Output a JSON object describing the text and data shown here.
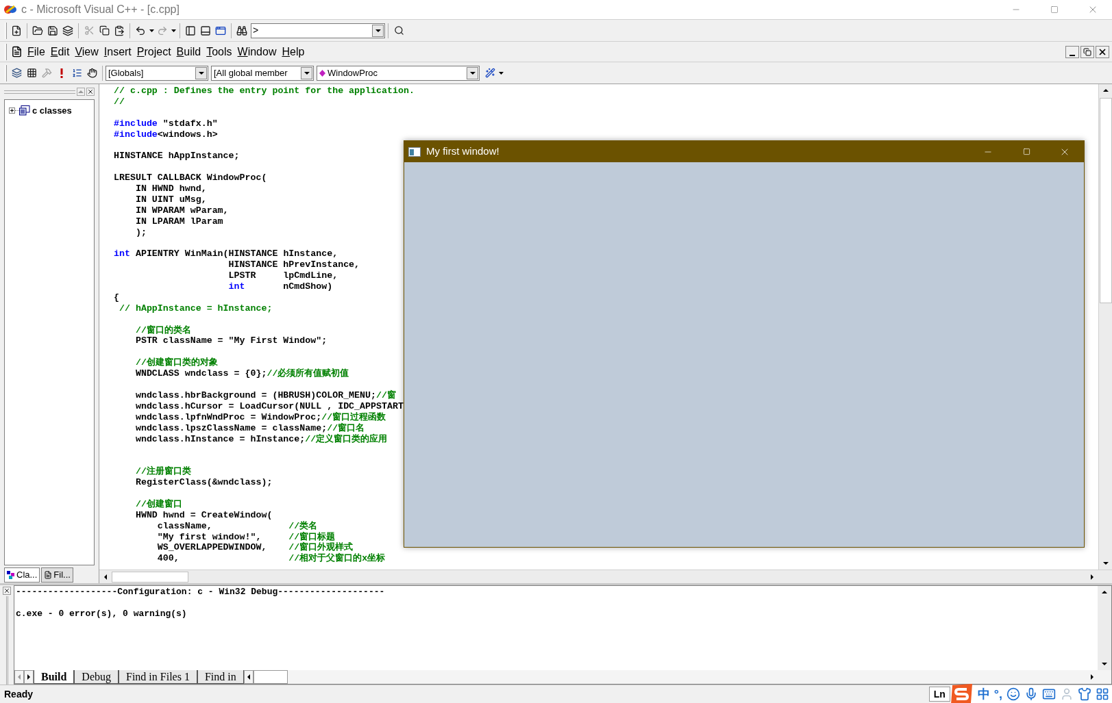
{
  "title_bar": {
    "title": "c - Microsoft Visual C++ - [c.cpp]"
  },
  "toolbar": {
    "find_combo": {
      "value": ">"
    }
  },
  "menu_bar": {
    "items": [
      "File",
      "Edit",
      "View",
      "Insert",
      "Project",
      "Build",
      "Tools",
      "Window",
      "Help"
    ]
  },
  "wizard_bar": {
    "combos": [
      {
        "kind": "plain",
        "value": "[Globals]"
      },
      {
        "kind": "plain",
        "value": "[All global member"
      },
      {
        "kind": "member",
        "value": "WindowProc"
      }
    ]
  },
  "workspace": {
    "tree": [
      {
        "label": "c classes",
        "expanded": false
      }
    ],
    "tabs": [
      {
        "label": "Cla...",
        "selected": true
      },
      {
        "label": "Fil...",
        "selected": false
      }
    ]
  },
  "editor": {
    "lines": [
      {
        "kind": "code",
        "segments": [
          {
            "kind": "comment",
            "text": "// c.cpp : Defines the entry point for the application."
          }
        ]
      },
      {
        "kind": "code",
        "segments": [
          {
            "kind": "comment",
            "text": "//"
          }
        ]
      },
      {
        "kind": "blank"
      },
      {
        "kind": "code",
        "segments": [
          {
            "kind": "keyword",
            "text": "#include"
          },
          {
            "kind": "plain",
            "text": " \"stdafx.h\""
          }
        ]
      },
      {
        "kind": "code",
        "segments": [
          {
            "kind": "keyword",
            "text": "#include"
          },
          {
            "kind": "plain",
            "text": "<windows.h>"
          }
        ]
      },
      {
        "kind": "blank"
      },
      {
        "kind": "code",
        "segments": [
          {
            "kind": "plain",
            "text": "HINSTANCE hAppInstance;"
          }
        ]
      },
      {
        "kind": "blank"
      },
      {
        "kind": "code",
        "segments": [
          {
            "kind": "plain",
            "text": "LRESULT CALLBACK WindowProc("
          }
        ]
      },
      {
        "kind": "code",
        "segments": [
          {
            "kind": "plain",
            "text": "    IN HWND hwnd,"
          }
        ]
      },
      {
        "kind": "code",
        "segments": [
          {
            "kind": "plain",
            "text": "    IN UINT uMsg,"
          }
        ]
      },
      {
        "kind": "code",
        "segments": [
          {
            "kind": "plain",
            "text": "    IN WPARAM wParam,"
          }
        ]
      },
      {
        "kind": "code",
        "segments": [
          {
            "kind": "plain",
            "text": "    IN LPARAM lParam"
          }
        ]
      },
      {
        "kind": "code",
        "segments": [
          {
            "kind": "plain",
            "text": "    );"
          }
        ]
      },
      {
        "kind": "blank"
      },
      {
        "kind": "code",
        "segments": [
          {
            "kind": "keyword",
            "text": "int"
          },
          {
            "kind": "plain",
            "text": " APIENTRY WinMain(HINSTANCE hInstance,"
          }
        ]
      },
      {
        "kind": "code",
        "segments": [
          {
            "kind": "plain",
            "text": "                     HINSTANCE hPrevInstance,"
          }
        ]
      },
      {
        "kind": "code",
        "segments": [
          {
            "kind": "plain",
            "text": "                     LPSTR     lpCmdLine,"
          }
        ]
      },
      {
        "kind": "code",
        "segments": [
          {
            "kind": "keyword",
            "text": "                     int"
          },
          {
            "kind": "plain",
            "text": "       nCmdShow)"
          }
        ]
      },
      {
        "kind": "code",
        "segments": [
          {
            "kind": "plain",
            "text": "{"
          }
        ]
      },
      {
        "kind": "code",
        "segments": [
          {
            "kind": "comment",
            "text": " // hAppInstance = hInstance;"
          }
        ]
      },
      {
        "kind": "blank"
      },
      {
        "kind": "code",
        "segments": [
          {
            "kind": "comment",
            "text": "    //窗口的类名"
          }
        ]
      },
      {
        "kind": "code",
        "segments": [
          {
            "kind": "plain",
            "text": "    PSTR className = \"My First Window\";"
          }
        ]
      },
      {
        "kind": "blank"
      },
      {
        "kind": "code",
        "segments": [
          {
            "kind": "comment",
            "text": "    //创建窗口类的对象"
          }
        ]
      },
      {
        "kind": "code",
        "segments": [
          {
            "kind": "plain",
            "text": "    WNDCLASS wndclass = {0};"
          },
          {
            "kind": "comment",
            "text": "//必须所有值赋初值"
          }
        ]
      },
      {
        "kind": "blank"
      },
      {
        "kind": "code",
        "segments": [
          {
            "kind": "plain",
            "text": "    wndclass.hbrBackground = (HBRUSH)COLOR_MENU;"
          },
          {
            "kind": "comment",
            "text": "//窗"
          }
        ]
      },
      {
        "kind": "code",
        "segments": [
          {
            "kind": "plain",
            "text": "    wndclass.hCursor = LoadCursor(NULL , IDC_APPSTART"
          }
        ]
      },
      {
        "kind": "code",
        "segments": [
          {
            "kind": "plain",
            "text": "    wndclass.lpfnWndProc = WindowProc;"
          },
          {
            "kind": "comment",
            "text": "//窗口过程函数"
          }
        ]
      },
      {
        "kind": "code",
        "segments": [
          {
            "kind": "plain",
            "text": "    wndclass.lpszClassName = className;"
          },
          {
            "kind": "comment",
            "text": "//窗口名"
          }
        ]
      },
      {
        "kind": "code",
        "segments": [
          {
            "kind": "plain",
            "text": "    wndclass.hInstance = hInstance;"
          },
          {
            "kind": "comment",
            "text": "//定义窗口类的应用"
          }
        ]
      },
      {
        "kind": "blank"
      },
      {
        "kind": "blank"
      },
      {
        "kind": "code",
        "segments": [
          {
            "kind": "comment",
            "text": "    //注册窗口类"
          }
        ]
      },
      {
        "kind": "code",
        "segments": [
          {
            "kind": "plain",
            "text": "    RegisterClass(&wndclass);"
          }
        ]
      },
      {
        "kind": "blank"
      },
      {
        "kind": "code",
        "segments": [
          {
            "kind": "comment",
            "text": "    //创建窗口"
          }
        ]
      },
      {
        "kind": "code",
        "segments": [
          {
            "kind": "plain",
            "text": "    HWND hwnd = CreateWindow("
          }
        ]
      },
      {
        "kind": "code",
        "segments": [
          {
            "kind": "plain",
            "text": "        className,              "
          },
          {
            "kind": "comment",
            "text": "//类名"
          }
        ]
      },
      {
        "kind": "code",
        "segments": [
          {
            "kind": "plain",
            "text": "        \"My first window!\",     "
          },
          {
            "kind": "comment",
            "text": "//窗口标题"
          }
        ]
      },
      {
        "kind": "code",
        "segments": [
          {
            "kind": "plain",
            "text": "        WS_OVERLAPPEDWINDOW,    "
          },
          {
            "kind": "comment",
            "text": "//窗口外观样式"
          }
        ]
      },
      {
        "kind": "code",
        "segments": [
          {
            "kind": "plain",
            "text": "        400,                    "
          },
          {
            "kind": "comment",
            "text": "//相对于父窗口的x坐标"
          }
        ]
      }
    ]
  },
  "app_window": {
    "title": "My first window!"
  },
  "output": {
    "lines": [
      {
        "kind": "text",
        "text": "-------------------Configuration: c - Win32 Debug--------------------"
      },
      {
        "kind": "blank"
      },
      {
        "kind": "text",
        "text": "c.exe - 0 error(s), 0 warning(s)"
      }
    ],
    "tabs": [
      {
        "label": "Build",
        "selected": true
      },
      {
        "label": "Debug",
        "selected": false
      },
      {
        "label": "Find in Files 1",
        "selected": false
      },
      {
        "label": "Find in",
        "selected": false
      }
    ]
  },
  "status_bar": {
    "text": "Ready",
    "ln": "Ln",
    "ime_mode": "中",
    "punctuation": "°,"
  }
}
